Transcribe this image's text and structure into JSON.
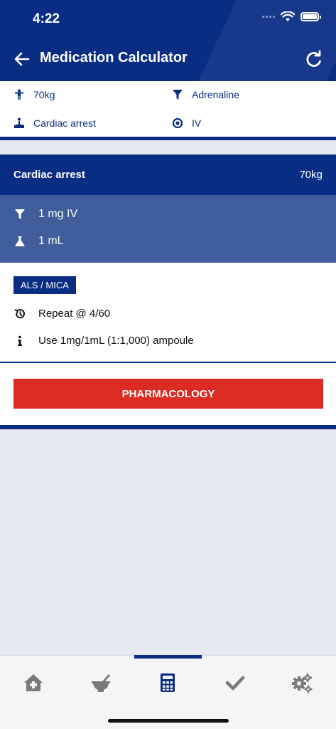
{
  "status_bar": {
    "time": "4:22"
  },
  "nav": {
    "title": "Medication Calculator"
  },
  "summary": {
    "weight": "70kg",
    "drug": "Adrenaline",
    "indication": "Cardiac arrest",
    "route": "IV"
  },
  "card": {
    "indication": "Cardiac arrest",
    "weight": "70kg",
    "dose": "1 mg IV",
    "volume": "1 mL"
  },
  "details": {
    "badge": "ALS / MICA",
    "repeat": "Repeat @ 4/60",
    "note": "Use 1mg/1mL (1:1,000) ampoule"
  },
  "actions": {
    "pharmacology_label": "PHARMACOLOGY"
  },
  "tabbar": {
    "tabs": [
      "home-tab",
      "drugs-tab",
      "calculator-tab",
      "checklist-tab",
      "settings-tab"
    ],
    "active": "calculator-tab"
  },
  "colors": {
    "primary": "#0a2d84",
    "dose_panel": "#3f5e9b",
    "accent_red": "#dc2b22",
    "background": "#e6e9f1"
  }
}
